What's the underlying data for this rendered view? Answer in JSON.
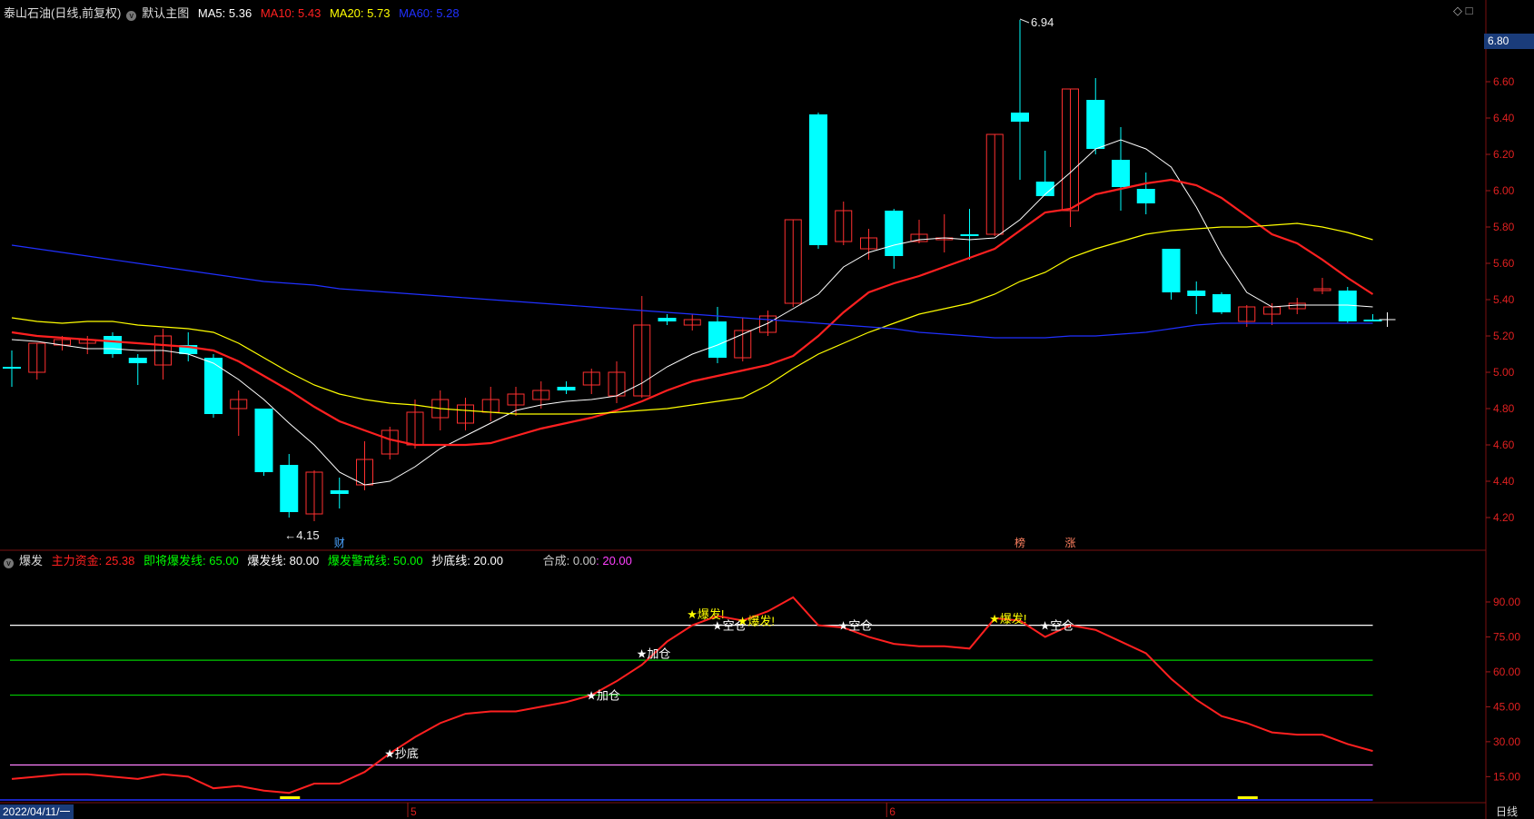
{
  "header": {
    "stock": "泰山石油(日线,前复权)",
    "main_chart": "默认主图",
    "ma": [
      {
        "label": "MA5: 5.36",
        "color": "#ffffff"
      },
      {
        "label": "MA10: 5.43",
        "color": "#ff2020"
      },
      {
        "label": "MA20: 5.73",
        "color": "#ffff00"
      },
      {
        "label": "MA60: 5.28",
        "color": "#2030ff"
      }
    ]
  },
  "indicator_header": {
    "name": "爆发",
    "items": [
      {
        "label": "主力资金: 25.38",
        "color": "#ff2020"
      },
      {
        "label": "即将爆发线: 65.00",
        "color": "#00ff00"
      },
      {
        "label": "爆发线: 80.00",
        "color": "#ffffff"
      },
      {
        "label": "爆发警戒线: 50.00",
        "color": "#00ff00"
      },
      {
        "label": "抄底线: 20.00",
        "color": "#ffffff"
      },
      {
        "label": "合成: 0.00",
        "color": "#c8c8c8"
      },
      {
        "label": ": 20.00",
        "color": "#ff40ff"
      }
    ]
  },
  "price_tag": "6.80",
  "corner_icons": "◇ □",
  "footer": {
    "date": "2022/04/11/一",
    "period": "日线"
  },
  "chart_data": [
    {
      "type": "candlestick",
      "ylim": [
        4.1,
        6.9
      ],
      "yticks": [
        "6.80",
        "6.60",
        "6.40",
        "6.20",
        "6.00",
        "5.80",
        "5.60",
        "5.40",
        "5.20",
        "5.00",
        "4.80",
        "4.60",
        "4.40",
        "4.20"
      ],
      "x_labels": [
        {
          "index": 16,
          "label": "5"
        },
        {
          "index": 35,
          "label": "6"
        }
      ],
      "candles": [
        [
          5.03,
          5.12,
          4.92,
          5.02
        ],
        [
          5.0,
          5.16,
          4.96,
          5.16
        ],
        [
          5.15,
          5.2,
          5.12,
          5.18
        ],
        [
          5.16,
          5.2,
          5.1,
          5.18
        ],
        [
          5.2,
          5.22,
          5.08,
          5.1
        ],
        [
          5.08,
          5.1,
          4.93,
          5.05
        ],
        [
          5.04,
          5.24,
          4.96,
          5.2
        ],
        [
          5.15,
          5.22,
          5.06,
          5.1
        ],
        [
          5.08,
          5.1,
          4.75,
          4.77
        ],
        [
          4.8,
          4.9,
          4.65,
          4.85
        ],
        [
          4.8,
          4.8,
          4.43,
          4.45
        ],
        [
          4.49,
          4.55,
          4.2,
          4.23
        ],
        [
          4.22,
          4.46,
          4.18,
          4.45
        ],
        [
          4.35,
          4.42,
          4.25,
          4.33
        ],
        [
          4.38,
          4.62,
          4.35,
          4.52
        ],
        [
          4.55,
          4.7,
          4.52,
          4.68
        ],
        [
          4.6,
          4.85,
          4.58,
          4.78
        ],
        [
          4.75,
          4.9,
          4.68,
          4.85
        ],
        [
          4.72,
          4.86,
          4.68,
          4.82
        ],
        [
          4.78,
          4.92,
          4.73,
          4.85
        ],
        [
          4.82,
          4.92,
          4.76,
          4.88
        ],
        [
          4.85,
          4.95,
          4.8,
          4.9
        ],
        [
          4.92,
          4.95,
          4.88,
          4.9
        ],
        [
          4.93,
          5.02,
          4.88,
          5.0
        ],
        [
          4.87,
          5.06,
          4.83,
          5.0
        ],
        [
          4.87,
          5.42,
          4.86,
          5.26
        ],
        [
          5.3,
          5.32,
          5.26,
          5.28
        ],
        [
          5.26,
          5.32,
          5.23,
          5.29
        ],
        [
          5.28,
          5.36,
          5.05,
          5.08
        ],
        [
          5.08,
          5.3,
          5.06,
          5.23
        ],
        [
          5.22,
          5.34,
          5.2,
          5.31
        ],
        [
          5.38,
          5.84,
          5.36,
          5.84
        ],
        [
          6.42,
          6.43,
          5.68,
          5.7
        ],
        [
          5.72,
          5.94,
          5.7,
          5.89
        ],
        [
          5.68,
          5.79,
          5.62,
          5.74
        ],
        [
          5.89,
          5.9,
          5.57,
          5.64
        ],
        [
          5.72,
          5.84,
          5.71,
          5.76
        ],
        [
          5.73,
          5.87,
          5.66,
          5.74
        ],
        [
          5.76,
          5.9,
          5.62,
          5.75
        ],
        [
          5.76,
          6.31,
          5.75,
          6.31
        ],
        [
          6.43,
          6.94,
          6.06,
          6.38
        ],
        [
          6.05,
          6.22,
          5.97,
          5.97
        ],
        [
          5.89,
          6.56,
          5.8,
          6.56
        ],
        [
          6.5,
          6.62,
          6.2,
          6.23
        ],
        [
          6.17,
          6.35,
          5.89,
          6.02
        ],
        [
          6.01,
          6.1,
          5.87,
          5.93
        ],
        [
          5.68,
          5.68,
          5.4,
          5.44
        ],
        [
          5.45,
          5.5,
          5.32,
          5.42
        ],
        [
          5.43,
          5.44,
          5.32,
          5.33
        ],
        [
          5.28,
          5.37,
          5.25,
          5.36
        ],
        [
          5.32,
          5.38,
          5.26,
          5.36
        ],
        [
          5.35,
          5.41,
          5.32,
          5.38
        ],
        [
          5.45,
          5.52,
          5.43,
          5.46
        ],
        [
          5.45,
          5.47,
          5.27,
          5.28
        ],
        [
          5.29,
          5.32,
          5.28,
          5.29
        ]
      ],
      "series": [
        {
          "name": "MA5",
          "color": "#ffffff",
          "values": [
            5.18,
            5.17,
            5.15,
            5.13,
            5.13,
            5.12,
            5.12,
            5.1,
            5.05,
            4.96,
            4.85,
            4.72,
            4.6,
            4.45,
            4.38,
            4.4,
            4.48,
            4.58,
            4.65,
            4.72,
            4.79,
            4.82,
            4.84,
            4.85,
            4.87,
            4.94,
            5.03,
            5.1,
            5.15,
            5.21,
            5.27,
            5.35,
            5.43,
            5.58,
            5.66,
            5.7,
            5.73,
            5.74,
            5.73,
            5.74,
            5.84,
            5.98,
            6.1,
            6.23,
            6.28,
            6.23,
            6.13,
            5.91,
            5.65,
            5.44,
            5.36,
            5.37,
            5.37,
            5.37,
            5.36
          ]
        },
        {
          "name": "MA10",
          "color": "#ff2020",
          "values": [
            5.22,
            5.2,
            5.19,
            5.18,
            5.17,
            5.16,
            5.15,
            5.14,
            5.12,
            5.06,
            4.98,
            4.9,
            4.81,
            4.73,
            4.68,
            4.63,
            4.6,
            4.6,
            4.6,
            4.61,
            4.65,
            4.69,
            4.72,
            4.75,
            4.79,
            4.84,
            4.9,
            4.95,
            4.98,
            5.01,
            5.04,
            5.09,
            5.2,
            5.33,
            5.44,
            5.49,
            5.53,
            5.58,
            5.63,
            5.68,
            5.78,
            5.88,
            5.9,
            5.98,
            6.01,
            6.04,
            6.06,
            6.03,
            5.96,
            5.86,
            5.76,
            5.71,
            5.62,
            5.52,
            5.43
          ]
        },
        {
          "name": "MA20",
          "color": "#ffff00",
          "values": [
            5.3,
            5.28,
            5.27,
            5.28,
            5.28,
            5.26,
            5.25,
            5.24,
            5.22,
            5.16,
            5.08,
            5.0,
            4.93,
            4.88,
            4.85,
            4.83,
            4.82,
            4.8,
            4.79,
            4.78,
            4.77,
            4.77,
            4.77,
            4.77,
            4.78,
            4.79,
            4.8,
            4.82,
            4.84,
            4.86,
            4.93,
            5.02,
            5.1,
            5.16,
            5.22,
            5.27,
            5.32,
            5.35,
            5.38,
            5.43,
            5.5,
            5.55,
            5.63,
            5.68,
            5.72,
            5.76,
            5.78,
            5.79,
            5.8,
            5.8,
            5.81,
            5.82,
            5.8,
            5.77,
            5.73
          ]
        },
        {
          "name": "MA60",
          "color": "#2030ff",
          "values": [
            5.7,
            5.68,
            5.66,
            5.64,
            5.62,
            5.6,
            5.58,
            5.56,
            5.54,
            5.52,
            5.5,
            5.49,
            5.48,
            5.46,
            5.45,
            5.44,
            5.43,
            5.42,
            5.41,
            5.4,
            5.39,
            5.38,
            5.37,
            5.36,
            5.35,
            5.34,
            5.33,
            5.32,
            5.31,
            5.3,
            5.29,
            5.28,
            5.27,
            5.26,
            5.25,
            5.24,
            5.22,
            5.21,
            5.2,
            5.19,
            5.19,
            5.19,
            5.2,
            5.2,
            5.21,
            5.22,
            5.24,
            5.26,
            5.27,
            5.27,
            5.27,
            5.27,
            5.27,
            5.27,
            5.27
          ]
        }
      ],
      "annotations": [
        {
          "index": 40,
          "price": 6.94,
          "label": "6.94"
        },
        {
          "index": 11,
          "price": 4.15,
          "label": "4.15"
        }
      ],
      "markers": [
        {
          "index": 13,
          "label": "财",
          "color": "#4aa3ff"
        },
        {
          "index": 40,
          "label": "榜",
          "color": "#ff8060"
        },
        {
          "index": 42,
          "label": "涨",
          "color": "#ff8060"
        }
      ]
    },
    {
      "type": "line",
      "ylim": [
        5,
        98
      ],
      "yticks": [
        "90.00",
        "75.00",
        "60.00",
        "45.00",
        "30.00",
        "15.00"
      ],
      "hlines": [
        {
          "value": 80,
          "color": "#ffffff"
        },
        {
          "value": 65,
          "color": "#00cc00"
        },
        {
          "value": 50,
          "color": "#00cc00"
        },
        {
          "value": 20,
          "color": "#ff80ff"
        }
      ],
      "series": [
        {
          "name": "主力资金",
          "color": "#ff2020",
          "values": [
            14,
            15,
            16,
            16,
            15,
            14,
            16,
            15,
            10,
            11,
            9,
            8,
            12,
            12,
            17,
            25,
            32,
            38,
            42,
            43,
            43,
            45,
            47,
            50,
            56,
            63,
            73,
            80,
            84,
            82,
            86,
            92,
            80,
            79,
            75,
            72,
            71,
            71,
            70,
            83,
            82,
            75,
            80,
            78,
            73,
            68,
            57,
            48,
            41,
            38,
            34,
            33,
            33,
            29,
            26
          ]
        }
      ],
      "signals": [
        {
          "index": 15,
          "value": 25,
          "label": "抄底"
        },
        {
          "index": 23,
          "value": 50,
          "label": "加仓"
        },
        {
          "index": 25,
          "value": 68,
          "label": "加仓"
        },
        {
          "index": 27,
          "value": 85,
          "label": "爆发!",
          "color": "#ffff00"
        },
        {
          "index": 28,
          "value": 80,
          "label": "空仓"
        },
        {
          "index": 29,
          "value": 82,
          "label": "爆发!",
          "color": "#ffff00"
        },
        {
          "index": 33,
          "value": 80,
          "label": "空仓"
        },
        {
          "index": 39,
          "value": 83,
          "label": "爆发!",
          "color": "#ffff00"
        },
        {
          "index": 41,
          "value": 80,
          "label": "空仓"
        }
      ],
      "bottom_marks": [
        11,
        49
      ]
    }
  ]
}
